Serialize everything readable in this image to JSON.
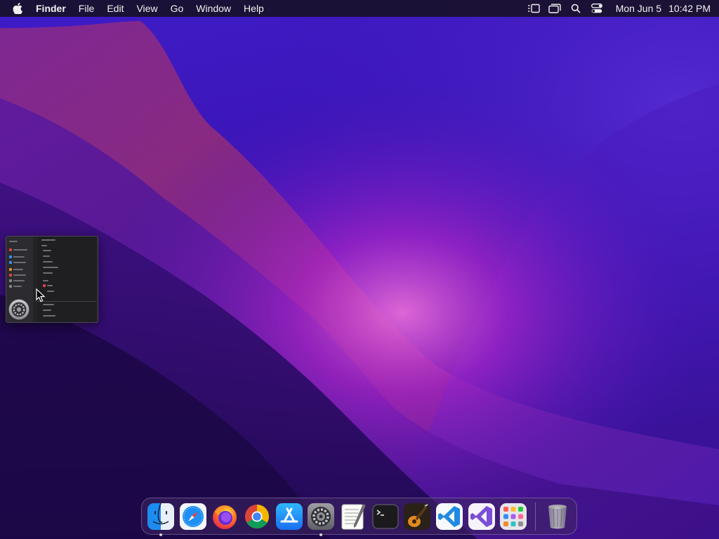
{
  "menubar": {
    "app_name": "Finder",
    "menus": [
      "File",
      "Edit",
      "View",
      "Go",
      "Window",
      "Help"
    ],
    "date": "Mon Jun 5",
    "time": "10:42 PM",
    "status_icons": [
      "stage-manager-icon",
      "screen-mirroring-icon",
      "spotlight-search-icon",
      "control-center-icon"
    ]
  },
  "dock": {
    "apps": [
      {
        "name": "Finder",
        "icon": "finder-icon",
        "running": true
      },
      {
        "name": "Safari",
        "icon": "safari-icon",
        "running": false
      },
      {
        "name": "Firefox",
        "icon": "firefox-icon",
        "running": false
      },
      {
        "name": "Google Chrome",
        "icon": "chrome-icon",
        "running": false
      },
      {
        "name": "App Store",
        "icon": "app-store-icon",
        "running": false
      },
      {
        "name": "System Settings",
        "icon": "system-settings-icon",
        "running": true
      },
      {
        "name": "TextEdit",
        "icon": "textedit-icon",
        "running": false
      },
      {
        "name": "Terminal",
        "icon": "terminal-icon",
        "running": false
      },
      {
        "name": "GarageBand",
        "icon": "garageband-icon",
        "running": false
      },
      {
        "name": "Visual Studio Code",
        "icon": "vscode-icon",
        "running": false
      },
      {
        "name": "Visual Studio",
        "icon": "visual-studio-icon",
        "running": false
      },
      {
        "name": "Launchpad",
        "icon": "launchpad-icon",
        "running": false
      }
    ],
    "trash": {
      "name": "Trash",
      "icon": "trash-icon"
    }
  },
  "window_thumbnail": {
    "app": "System Settings",
    "icon": "system-settings-icon"
  },
  "colors": {
    "wallpaper_top": "#3b18c6",
    "wallpaper_bottom": "#1d0a4a",
    "wallpaper_ridge": "#b8346e",
    "wallpaper_glow": "#d05bd8",
    "menubar_bg": "#16102280"
  }
}
